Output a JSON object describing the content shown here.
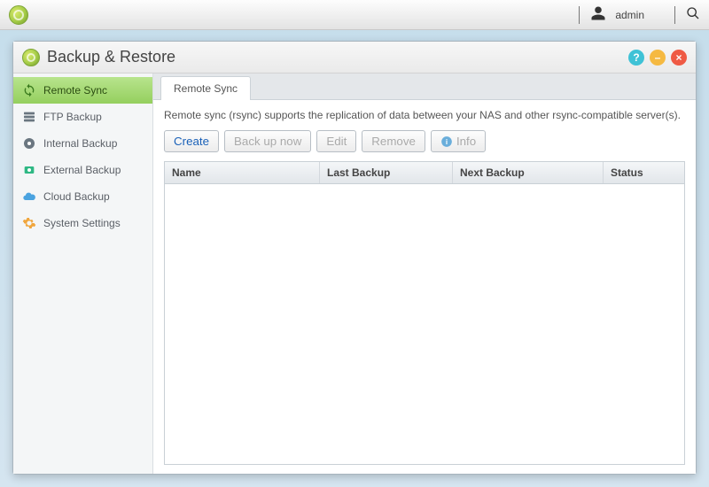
{
  "taskbar": {
    "username": "admin"
  },
  "window": {
    "title": "Backup & Restore"
  },
  "sidebar": {
    "items": [
      {
        "label": "Remote Sync",
        "active": true
      },
      {
        "label": "FTP Backup",
        "active": false
      },
      {
        "label": "Internal Backup",
        "active": false
      },
      {
        "label": "External Backup",
        "active": false
      },
      {
        "label": "Cloud Backup",
        "active": false
      },
      {
        "label": "System Settings",
        "active": false
      }
    ]
  },
  "tabs": {
    "active": "Remote Sync"
  },
  "description": "Remote sync (rsync) supports the replication of data between your NAS and other rsync-compatible server(s).",
  "toolbar": {
    "create": "Create",
    "backup_now": "Back up now",
    "edit": "Edit",
    "remove": "Remove",
    "info": "Info"
  },
  "table": {
    "headers": {
      "name": "Name",
      "last_backup": "Last Backup",
      "next_backup": "Next Backup",
      "status": "Status"
    },
    "rows": []
  }
}
